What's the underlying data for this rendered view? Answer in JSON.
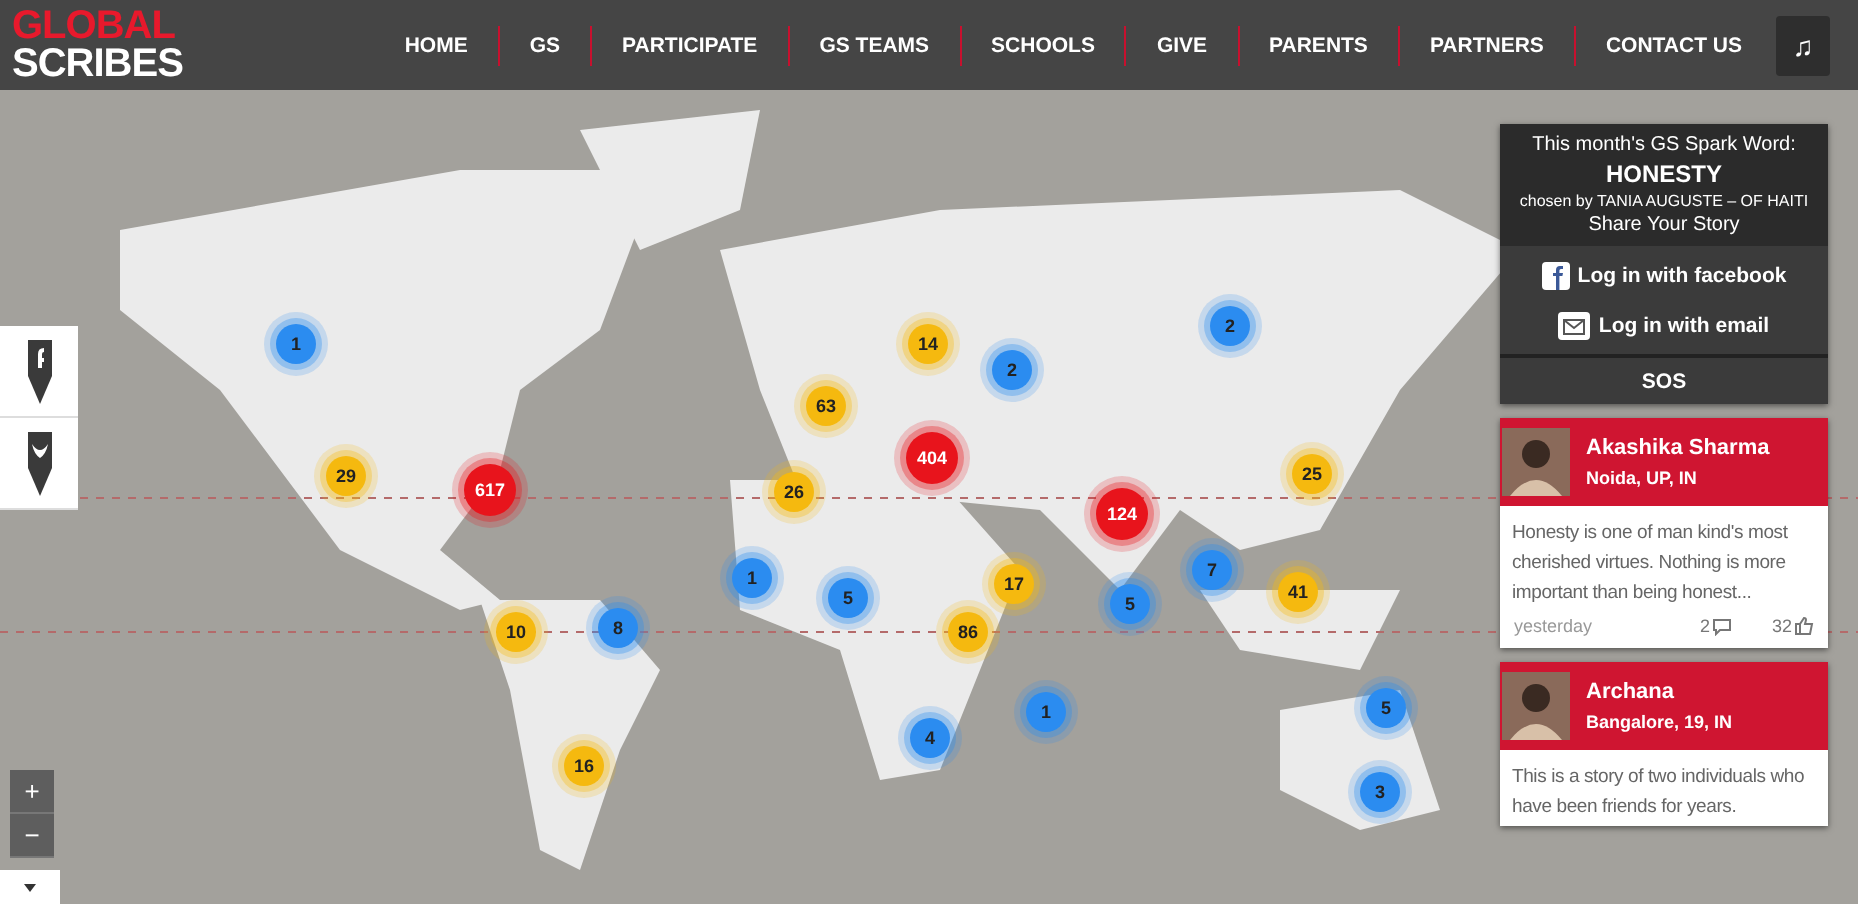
{
  "header": {
    "logo": {
      "line_1": "GLOBAL",
      "line_2": "SCRIBES"
    },
    "nav": [
      "HOME",
      "GS",
      "PARTICIPATE",
      "GS TEAMS",
      "SCHOOLS",
      "GIVE",
      "PARENTS",
      "PARTNERS",
      "CONTACT US"
    ],
    "music_button": "♫"
  },
  "map": {
    "kind": "picture",
    "markers": [
      {
        "count": "1",
        "color": "#2b8cf0"
      },
      {
        "count": "29",
        "color": "#f5b90f"
      },
      {
        "count": "617",
        "color": "#e8141c"
      },
      {
        "count": "63",
        "color": "#f5b90f"
      },
      {
        "count": "14",
        "color": "#f5b90f"
      },
      {
        "count": "2",
        "color": "#2b8cf0"
      },
      {
        "count": "2",
        "color": "#2b8cf0"
      },
      {
        "count": "26",
        "color": "#f5b90f"
      },
      {
        "count": "404",
        "color": "#e8141c"
      },
      {
        "count": "17",
        "color": "#f5b90f"
      },
      {
        "count": "124",
        "color": "#e8141c"
      },
      {
        "count": "25",
        "color": "#f5b90f"
      },
      {
        "count": "1",
        "color": "#2b8cf0"
      },
      {
        "count": "5",
        "color": "#2b8cf0"
      },
      {
        "count": "5",
        "color": "#2b8cf0"
      },
      {
        "count": "7",
        "color": "#2b8cf0"
      },
      {
        "count": "41",
        "color": "#f5b90f"
      },
      {
        "count": "10",
        "color": "#f5b90f"
      },
      {
        "count": "8",
        "color": "#2b8cf0"
      },
      {
        "count": "86",
        "color": "#f5b90f"
      },
      {
        "count": "1",
        "color": "#2b8cf0"
      },
      {
        "count": "4",
        "color": "#2b8cf0"
      },
      {
        "count": "5",
        "color": "#2b8cf0"
      },
      {
        "count": "3",
        "color": "#2b8cf0"
      },
      {
        "count": "16",
        "color": "#f5b90f"
      }
    ],
    "zoom_in": "+",
    "zoom_out": "−"
  },
  "spark": {
    "intro": "This month's GS Spark Word:",
    "word": "HONESTY",
    "chosen_by": "chosen by TANIA AUGUSTE – OF HAITI",
    "share": "Share Your Story",
    "login_facebook": "Log in with facebook",
    "login_email": "Log in with email",
    "sos": "SOS"
  },
  "stories": [
    {
      "name": "Akashika Sharma",
      "place": "Noida, UP, IN",
      "text": "Honesty is one of man kind's most cherished virtues. Nothing is more important than being honest...",
      "time": "yesterday",
      "comments": "2",
      "likes": "32"
    },
    {
      "name": "Archana",
      "place": "Bangalore, 19, IN",
      "text": "This is a story of two individuals who have been friends for years."
    }
  ]
}
